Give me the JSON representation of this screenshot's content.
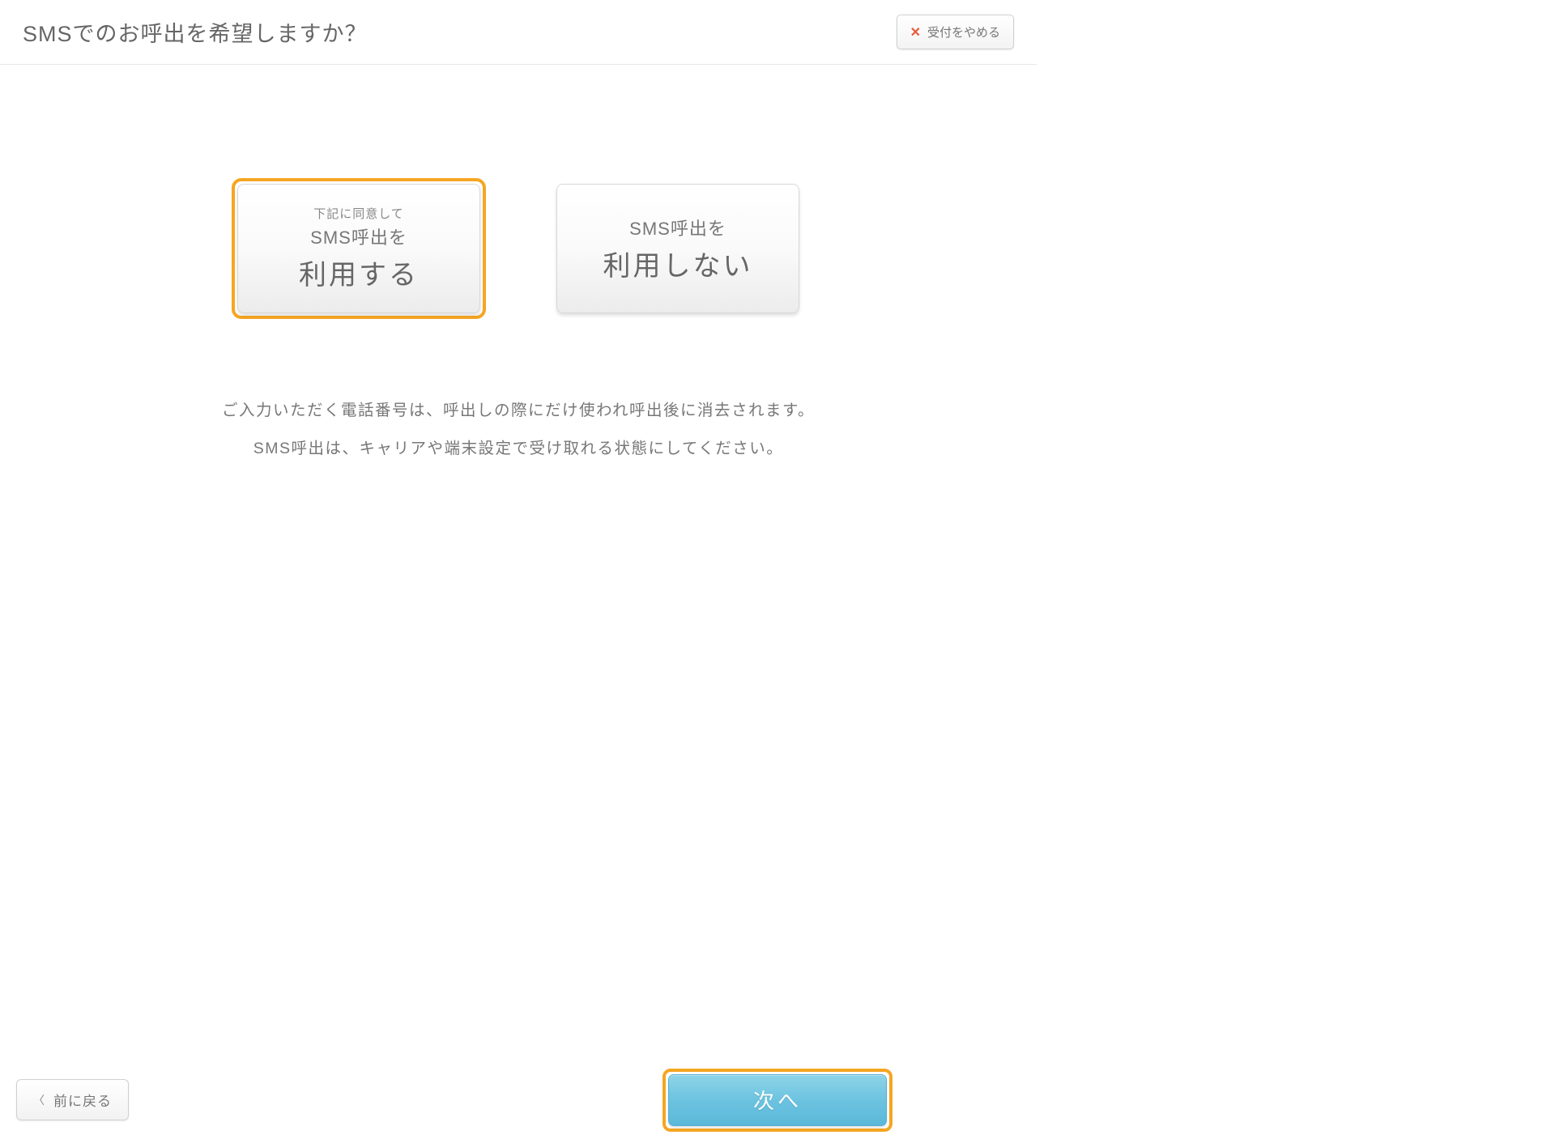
{
  "header": {
    "title": "SMSでのお呼出を希望しますか？",
    "cancel_label": "受付をやめる"
  },
  "options": {
    "use": {
      "small_text": "下記に同意して",
      "medium_text": "SMS呼出を",
      "large_text": "利用する",
      "selected": true
    },
    "not_use": {
      "medium_text": "SMS呼出を",
      "large_text": "利用しない",
      "selected": false
    }
  },
  "info": {
    "line1": "ご入力いただく電話番号は、呼出しの際にだけ使われ呼出後に消去されます。",
    "line2": "SMS呼出は、キャリアや端末設定で受け取れる状態にしてください。"
  },
  "footer": {
    "back_label": "前に戻る",
    "next_label": "次へ"
  },
  "colors": {
    "accent_orange": "#f5a623",
    "close_red": "#e85a3a",
    "next_blue": "#6cc3e0"
  }
}
